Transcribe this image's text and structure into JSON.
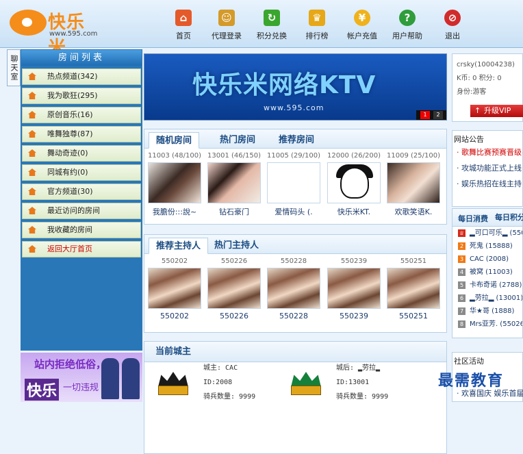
{
  "header": {
    "logo_text": "快乐米",
    "logo_url": "www.595.com",
    "nav": [
      {
        "label": "首页",
        "icon": "home-icon",
        "color": "#e55a2b"
      },
      {
        "label": "代理登录",
        "icon": "agent-user-icon",
        "color": "#d49a2a"
      },
      {
        "label": "积分兑换",
        "icon": "exchange-icon",
        "color": "#3aa62e"
      },
      {
        "label": "排行榜",
        "icon": "crown-icon",
        "color": "#e6a818"
      },
      {
        "label": "帐户充值",
        "icon": "coin-icon",
        "color": "#efb21b"
      },
      {
        "label": "用户帮助",
        "icon": "help-icon",
        "color": "#2f9d3a"
      },
      {
        "label": "退出",
        "icon": "exit-icon",
        "color": "#d22b2b"
      }
    ]
  },
  "left": {
    "side_tab": "聊天室",
    "list_title": "房间列表",
    "items": [
      {
        "label": "热点频道(342)"
      },
      {
        "label": "我为歌狂(295)"
      },
      {
        "label": "原创音乐(16)"
      },
      {
        "label": "唯舞独尊(87)"
      },
      {
        "label": "舞动奇迹(0)"
      },
      {
        "label": "同城有约(0)"
      },
      {
        "label": "官方频道(30)"
      },
      {
        "label": "最近访问的房间"
      },
      {
        "label": "我收藏的房间"
      },
      {
        "label": "返回大厅首页"
      }
    ],
    "banner_text1": "站内拒绝低俗，",
    "banner_text2": "快乐",
    "banner_text3": "一切违规"
  },
  "ktv_banner": {
    "title": "快乐米网络KTV",
    "url": "www.595.com",
    "page1": "1",
    "page2": "2"
  },
  "rooms": {
    "tabs": [
      "随机房间",
      "热门房间",
      "推荐房间"
    ],
    "cards": [
      {
        "cap": "11003 (48/100)",
        "name": "我膽份:::說~"
      },
      {
        "cap": "13001 (46/150)",
        "name": "钻石豪门"
      },
      {
        "cap": "11005 (29/100)",
        "name": "爱情码头 (."
      },
      {
        "cap": "12000 (26/200)",
        "name": "快乐米KT."
      },
      {
        "cap": "11009 (25/100)",
        "name": "欢歌笑语K."
      }
    ]
  },
  "hosts": {
    "tabs": [
      "推荐主持人",
      "热门主持人"
    ],
    "cards": [
      {
        "cap": "550202",
        "name": "550202"
      },
      {
        "cap": "550226",
        "name": "550226"
      },
      {
        "cap": "550228",
        "name": "550228"
      },
      {
        "cap": "550239",
        "name": "550239"
      },
      {
        "cap": "550251",
        "name": "550251"
      }
    ]
  },
  "castle": {
    "title": "当前城主",
    "lord": {
      "name": "城主: CAC",
      "id": "ID:2008",
      "soldiers": "骑兵数量: 9999"
    },
    "queen": {
      "name": "城后: ▂劳拉▂",
      "id": "ID:13001",
      "soldiers": "骑兵数量: 9999"
    }
  },
  "user": {
    "name": "crsky(10004238)",
    "balance": "K币: 0 积分: 0",
    "identity": "身份:游客",
    "vip_button": "升级VIP"
  },
  "notice": {
    "title": "网站公告",
    "items": [
      {
        "text": "· 歌舞比赛预赛晋级名"
      },
      {
        "text": "· 攻城功能正式上线"
      },
      {
        "text": "· 娱乐热招在线主持"
      }
    ]
  },
  "ranking": {
    "tabs": [
      "每日消费",
      "每日积分"
    ],
    "rows": [
      {
        "num": "",
        "text": "▂可口可乐▂ (550"
      },
      {
        "num": "2",
        "text": "死鬼 (15888)"
      },
      {
        "num": "3",
        "text": "CAC (2008)"
      },
      {
        "num": "4",
        "text": "被窝 (11003)"
      },
      {
        "num": "5",
        "text": "卡布奇诺 (2788)"
      },
      {
        "num": "6",
        "text": "▂劳拉▂ (13001)"
      },
      {
        "num": "7",
        "text": "华★哥 (1888)"
      },
      {
        "num": "8",
        "text": "Mrs亚芳. (55026"
      }
    ]
  },
  "community": {
    "title": "社区活动",
    "line": "· 欢喜国庆 娱乐首届"
  },
  "watermark": "最需教育"
}
